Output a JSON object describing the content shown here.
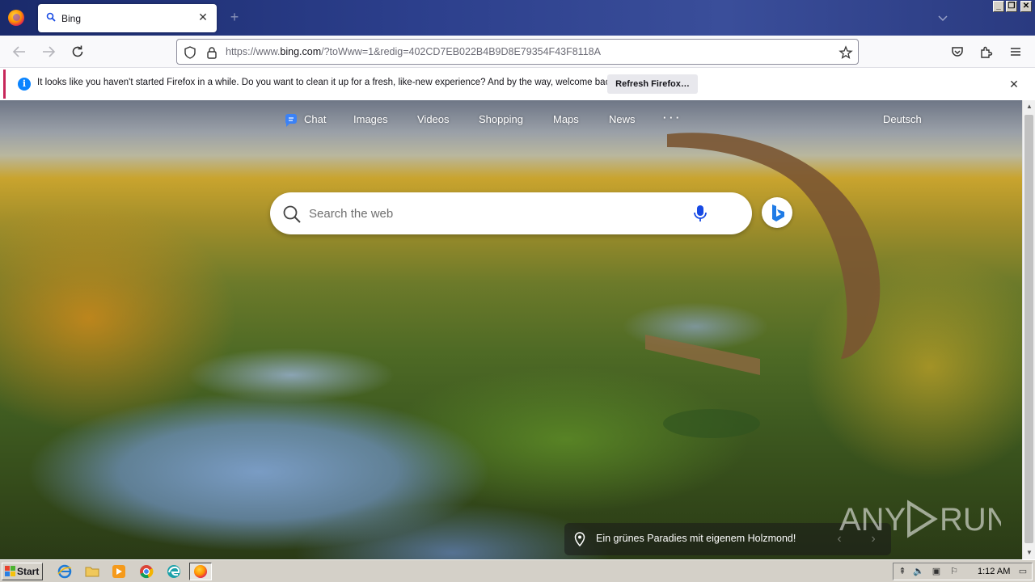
{
  "browser": {
    "tab": {
      "title": "Bing"
    },
    "url": {
      "prefix": "https://www.",
      "domain": "bing.com",
      "path": "/?toWww=1&redig=402CD7EB022B4B9D8E79354F43F8118A"
    },
    "notification": {
      "message": "It looks like you haven't started Firefox in a while. Do you want to clean it up for a fresh, like-new experience? And by the way, welcome back!",
      "button_label": "Refresh Firefox…"
    }
  },
  "bing": {
    "nav": {
      "chat": "Chat",
      "images": "Images",
      "videos": "Videos",
      "shopping": "Shopping",
      "maps": "Maps",
      "news": "News",
      "more": "· · ·",
      "language": "Deutsch"
    },
    "search": {
      "placeholder": "Search the web"
    },
    "caption": "Ein grünes Paradies mit eigenem Holzmond!",
    "accent_color": "#174ae4"
  },
  "watermark": {
    "text": "ANY RUN"
  },
  "taskbar": {
    "start_label": "Start",
    "clock": "1:12 AM",
    "pinned_icons": [
      "internet-explorer-icon",
      "folder-icon",
      "media-player-icon",
      "chrome-icon",
      "edge-icon",
      "firefox-icon"
    ]
  }
}
